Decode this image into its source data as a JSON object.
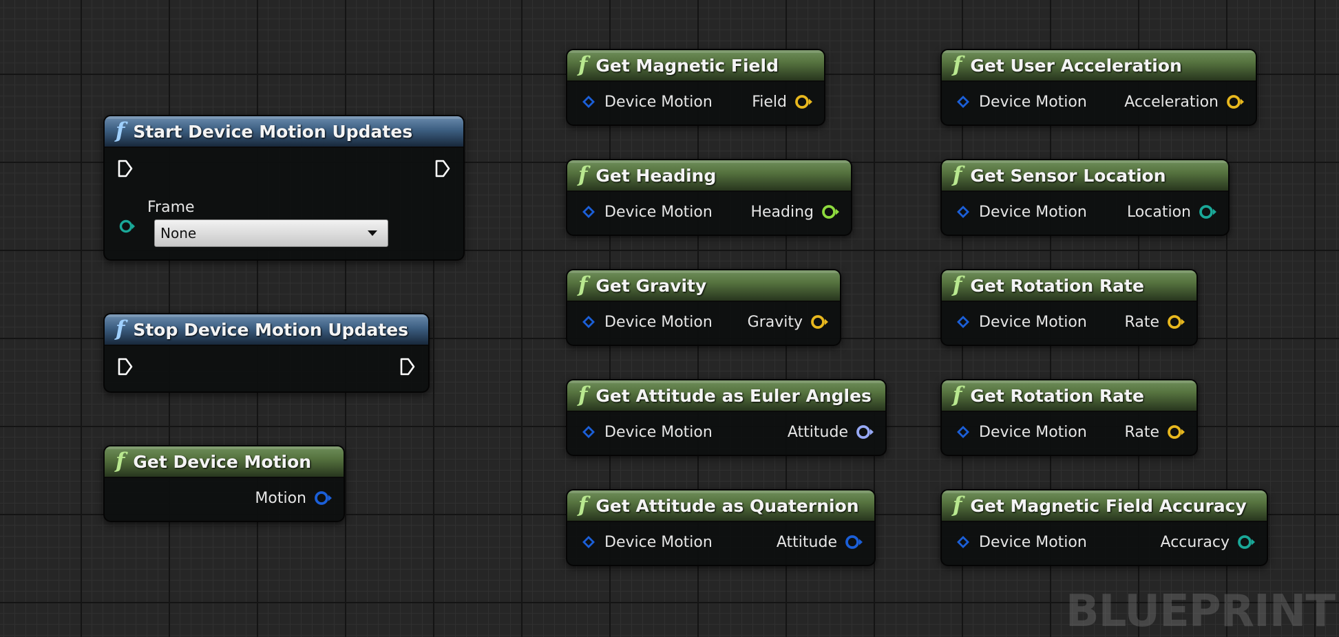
{
  "colors": {
    "pin_struct": "#1b5fd8",
    "pin_vector": "#e8b81e",
    "pin_rotator": "#97a9f5",
    "pin_float": "#8edb3e",
    "pin_teal": "#1aa898",
    "pin_exec": "#ffffff",
    "header_pure": "#56733f",
    "header_impure": "#3d5f82"
  },
  "nodes": {
    "start_updates": {
      "title": "Start Device Motion Updates",
      "icon": "function-icon",
      "frame_label": "Frame",
      "frame_value": "None"
    },
    "stop_updates": {
      "title": "Stop Device Motion Updates",
      "icon": "function-icon"
    },
    "get_device_motion": {
      "title": "Get Device Motion",
      "icon": "function-icon",
      "output": "Motion"
    },
    "magnetic_field": {
      "title": "Get Magnetic Field",
      "input": "Device Motion",
      "output": "Field"
    },
    "heading": {
      "title": "Get Heading",
      "input": "Device Motion",
      "output": "Heading"
    },
    "gravity": {
      "title": "Get Gravity",
      "input": "Device Motion",
      "output": "Gravity"
    },
    "euler": {
      "title": "Get Attitude as Euler Angles",
      "input": "Device Motion",
      "output": "Attitude"
    },
    "quaternion": {
      "title": "Get Attitude as Quaternion",
      "input": "Device Motion",
      "output": "Attitude"
    },
    "user_accel": {
      "title": "Get User Acceleration",
      "input": "Device Motion",
      "output": "Acceleration"
    },
    "sensor_location": {
      "title": "Get Sensor Location",
      "input": "Device Motion",
      "output": "Location"
    },
    "rotation_rate_1": {
      "title": "Get Rotation Rate",
      "input": "Device Motion",
      "output": "Rate"
    },
    "rotation_rate_2": {
      "title": "Get Rotation Rate",
      "input": "Device Motion",
      "output": "Rate"
    },
    "mag_accuracy": {
      "title": "Get Magnetic Field Accuracy",
      "input": "Device Motion",
      "output": "Accuracy"
    }
  },
  "watermark": "BLUEPRINT"
}
